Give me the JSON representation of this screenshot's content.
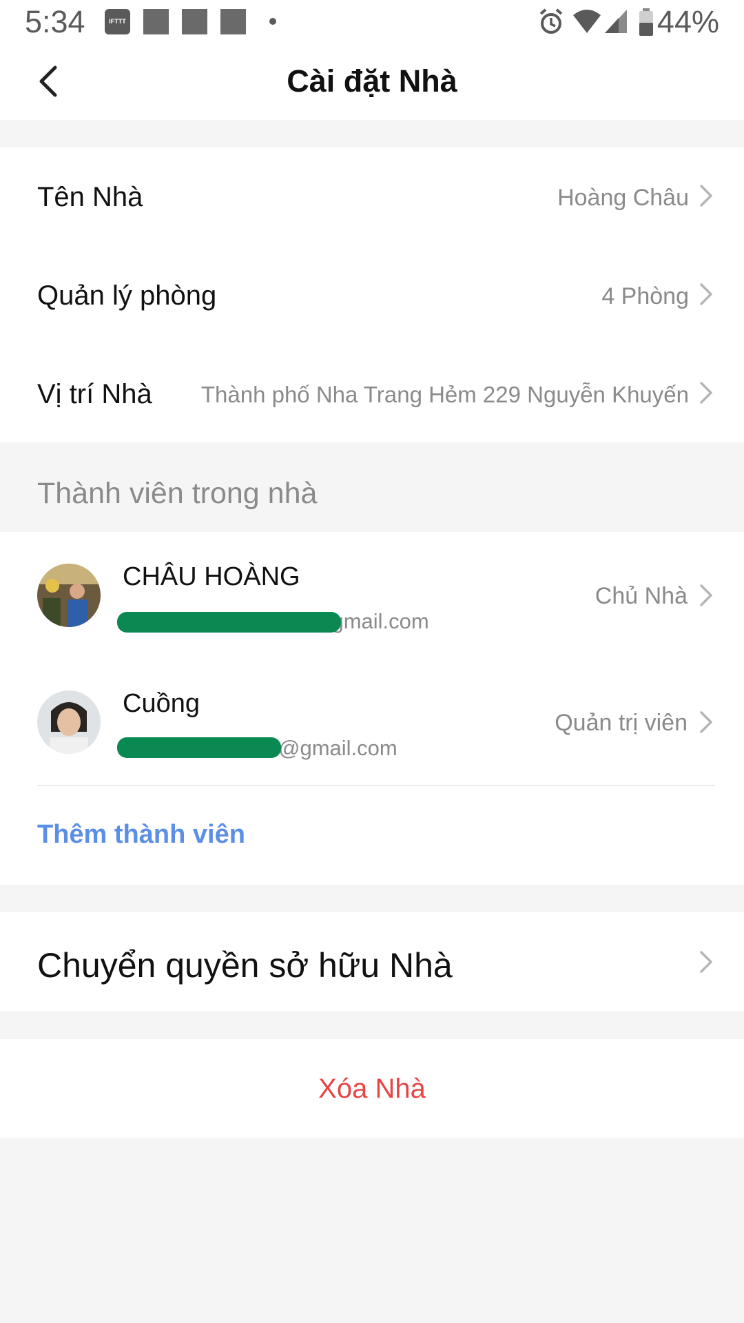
{
  "status_bar": {
    "time": "5:34",
    "ifttt_label": "IFTTT",
    "battery_percent": "44%",
    "icons": [
      "ifttt-icon",
      "notification-square-icon",
      "notification-square-icon",
      "notification-square-icon",
      "dot-icon",
      "alarm-icon",
      "wifi-icon",
      "signal-icon",
      "battery-icon"
    ]
  },
  "header": {
    "title": "Cài đặt Nhà",
    "back_icon": "chevron-left-icon"
  },
  "home_settings": {
    "items": [
      {
        "label": "Tên Nhà",
        "value": "Hoàng Châu"
      },
      {
        "label": "Quản lý phòng",
        "value": "4 Phòng"
      },
      {
        "label": "Vị trí Nhà",
        "value": "Thành phố Nha Trang Hẻm 229 Nguyễn Khuyến"
      }
    ]
  },
  "members": {
    "section_title": "Thành viên trong nhà",
    "list": [
      {
        "name": "CHÂU HOÀNG",
        "email_visible": "@gmail.com",
        "role": "Chủ Nhà"
      },
      {
        "name": "Cuồng",
        "email_visible": "@gmail.com",
        "role": "Quản trị viên"
      }
    ],
    "add_label": "Thêm thành viên"
  },
  "transfer": {
    "label": "Chuyển quyền sở hữu Nhà"
  },
  "delete": {
    "label": "Xóa Nhà"
  },
  "colors": {
    "accent_blue": "#5b8ee6",
    "danger_red": "#e64545",
    "secondary_text": "#8a8a8a",
    "redaction_green": "#0a8a52"
  }
}
